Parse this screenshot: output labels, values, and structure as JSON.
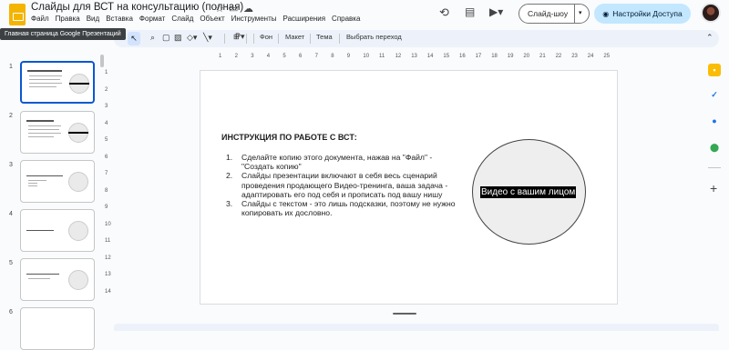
{
  "header": {
    "title": "Слайды для ВСТ на консультацию (полная)",
    "tooltip": "Главная страница Google Презентаций",
    "menu": [
      "Файл",
      "Правка",
      "Вид",
      "Вставка",
      "Формат",
      "Слайд",
      "Объект",
      "Инструменты",
      "Расширения",
      "Справка"
    ],
    "slideshow_label": "Слайд-шоу",
    "access_label": "Настройки Доступа"
  },
  "toolbar": {
    "items": [
      "Фон",
      "Макет",
      "Тема",
      "Выбрать переход"
    ]
  },
  "filmstrip": {
    "numbers": [
      "1",
      "2",
      "3",
      "4",
      "5",
      "6"
    ]
  },
  "ruler": {
    "h": [
      "1",
      "2",
      "3",
      "4",
      "5",
      "6",
      "7",
      "8",
      "9",
      "10",
      "11",
      "12",
      "13",
      "14",
      "15",
      "16",
      "17",
      "18",
      "19",
      "20",
      "21",
      "22",
      "23",
      "24",
      "25"
    ],
    "v": [
      "1",
      "2",
      "3",
      "4",
      "5",
      "6",
      "7",
      "8",
      "9",
      "10",
      "11",
      "12",
      "13",
      "14"
    ]
  },
  "slide": {
    "title": "ИНСТРУКЦИЯ ПО РАБОТЕ С ВСТ:",
    "items": [
      {
        "num": "1.",
        "text": "Сделайте копию этого документа, нажав на \"Файл\" - \"Создать копию\""
      },
      {
        "num": "2.",
        "text": "Слайды презентации включают в себя весь сценарий проведения продающего Видео-тренинга, ваша задача - адаптировать его под себя и прописать под вашу нишу"
      },
      {
        "num": "3.",
        "text": "Слайды с текстом - это лишь подсказки, поэтому не нужно копировать их дословно."
      }
    ],
    "video_label": "Видео с вашим лицом"
  },
  "colors": {
    "accent": "#0b57d0",
    "access_button": "#c2e7ff",
    "slides_logo": "#f4b400"
  }
}
